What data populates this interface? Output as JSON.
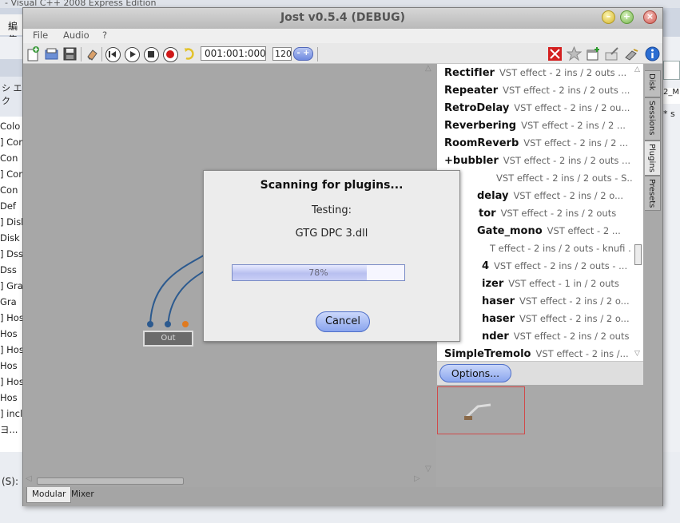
{
  "background_ide": {
    "title": "- Visual C++ 2008 Express Edition",
    "menu_label": "編集",
    "solution_label": "シ エク",
    "tree_items": [
      "Colo",
      "] Con",
      "Con",
      "] Con",
      "Con",
      "Def",
      "] Disk",
      "Disk",
      "] Dss",
      "Dss",
      "] Gra",
      "Gra",
      "] Hos",
      "Hos",
      "] Hos",
      "Hos",
      "] Hos",
      "Hos",
      "] inclu"
    ],
    "tree_more": "ヨ...",
    "status_text": "(S):",
    "right_tab": "* s",
    "right_text": "2_M"
  },
  "window": {
    "title": "Jost v0.5.4 (DEBUG)",
    "minimize_glyph": "–",
    "maximize_glyph": "+",
    "close_glyph": "×"
  },
  "menu": {
    "file": "File",
    "audio": "Audio",
    "help": "?"
  },
  "toolbar": {
    "position": "001:001:000",
    "bpm": "120",
    "bpm_spin": "- +"
  },
  "canvas": {
    "out_label": "Out"
  },
  "tabs": {
    "modular": "Modular",
    "mixer": "Mixer"
  },
  "plugin_list": {
    "rows": [
      {
        "name": "RectifIer",
        "desc": "VST effect - 2 ins / 2 outs ..."
      },
      {
        "name": "Repeater",
        "desc": "VST effect - 2 ins / 2 outs ..."
      },
      {
        "name": "RetroDelay",
        "desc": "VST effect - 2 ins / 2 ou..."
      },
      {
        "name": "Reverbering",
        "desc": "VST effect - 2 ins / 2 ..."
      },
      {
        "name": "RoomReverb",
        "desc": "VST effect - 2 ins / 2 ..."
      },
      {
        "name": "+bubbler",
        "desc": "VST effect - 2 ins / 2 outs ..."
      },
      {
        "name": "",
        "desc": "VST effect - 2 ins / 2 outs - S..."
      },
      {
        "name": "delay",
        "desc": "VST effect - 2 ins / 2 o..."
      },
      {
        "name": "tor",
        "desc": "VST effect - 2 ins / 2 outs"
      },
      {
        "name": "Gate_mono",
        "desc": "VST effect - 2 ..."
      },
      {
        "name": "",
        "desc": "T effect - 2 ins / 2 outs - knufi ..."
      },
      {
        "name": "4",
        "desc": "VST effect - 2 ins / 2 outs - ..."
      },
      {
        "name": "izer",
        "desc": "VST effect - 1 in / 2 outs"
      },
      {
        "name": "haser",
        "desc": "VST effect - 2 ins / 2 o..."
      },
      {
        "name": "haser",
        "desc": "VST effect - 2 ins / 2 o..."
      },
      {
        "name": "nder",
        "desc": "VST effect - 2 ins / 2 outs"
      },
      {
        "name": "SimpleTremolo",
        "desc": "VST effect - 2 ins /..."
      }
    ],
    "options_button": "Options..."
  },
  "side_tabs": {
    "disk": "Disk",
    "sessions": "Sessions",
    "plugins": "Plugins",
    "presets": "Presets"
  },
  "dialog": {
    "title": "Scanning for plugins...",
    "subtitle": "Testing:",
    "file": "GTG DPC 3.dll",
    "progress_percent": 78,
    "progress_text": "78%",
    "cancel_button": "Cancel"
  },
  "colors": {
    "progress_border": "#7a8cc6",
    "button_blue": "#89a4ee",
    "cable_blue": "#2c5a8f",
    "pin_orange": "#e07a1f",
    "selection_red": "#d04a4a"
  }
}
